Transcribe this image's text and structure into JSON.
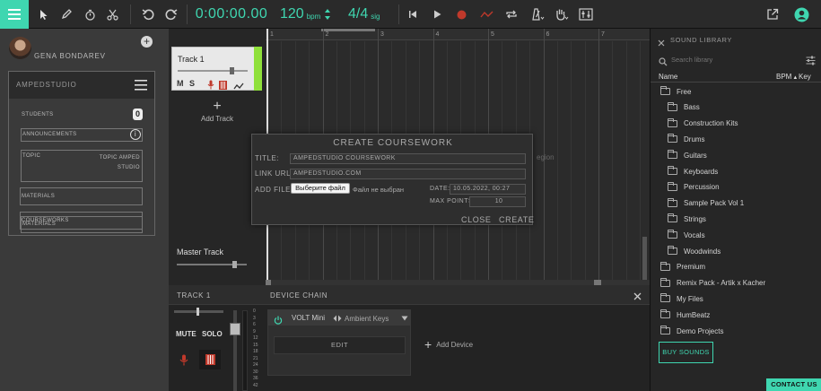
{
  "topbar": {
    "time": "0:00:00.00",
    "tempo": "120",
    "tempo_unit": "bpm",
    "signature": "4/4",
    "signature_unit": "sig"
  },
  "user": {
    "name": "GENA BONDAREV"
  },
  "lms": {
    "brand": "AMPEDSTUDIO",
    "students_label": "STUDENTS",
    "students_count": "0",
    "announcements_label": "ANNOUNCEMENTS",
    "topic_label": "TOPIC",
    "topic_value": "TOPIC AMPED STUDIO",
    "materials_label": "MATERIALS",
    "coursework_label": "COURSEWORKS"
  },
  "tracks": [
    {
      "name": "Track 1",
      "mute": "M",
      "solo": "S"
    }
  ],
  "add_track": "Add Track",
  "master_track": "Master Track",
  "ruler": [
    "1",
    "2",
    "3",
    "4",
    "5",
    "6",
    "7"
  ],
  "region_hint": "egion",
  "coursework": {
    "title": "CREATE COURSEWORK",
    "title_label": "TITLE:",
    "title_value": "AMPEDSTUDIO COURSEWORK",
    "link_label": "LINK URL:",
    "link_value": "AMPEDSTUDIO.COM",
    "file_label": "ADD FILE:",
    "file_button": "Выберите файл",
    "file_status": "Файл не выбран",
    "date_label": "DATE:",
    "date_value": "10.05.2022, 00:27",
    "max_label": "MAX POINTS:",
    "max_value": "10",
    "close": "CLOSE",
    "create": "CREATE"
  },
  "channel": {
    "name": "TRACK 1",
    "mute": "MUTE",
    "solo": "SOLO",
    "meter_ticks": [
      "0",
      "3",
      "6",
      "9",
      "12",
      "15",
      "18",
      "21",
      "24",
      "30",
      "36",
      "42"
    ]
  },
  "device_chain": {
    "title": "DEVICE CHAIN",
    "device": "VOLT Mini",
    "preset": "Ambient Keys",
    "edit": "EDIT",
    "add": "Add Device"
  },
  "library": {
    "title": "SOUND LIBRARY",
    "search_placeholder": "Search library",
    "col_name": "Name",
    "col_bpm": "BPM",
    "col_key": "Key",
    "items": [
      {
        "label": "Free",
        "indent": 0
      },
      {
        "label": "Bass",
        "indent": 1
      },
      {
        "label": "Construction Kits",
        "indent": 1
      },
      {
        "label": "Drums",
        "indent": 1
      },
      {
        "label": "Guitars",
        "indent": 1
      },
      {
        "label": "Keyboards",
        "indent": 1
      },
      {
        "label": "Percussion",
        "indent": 1
      },
      {
        "label": "Sample Pack Vol 1",
        "indent": 1
      },
      {
        "label": "Strings",
        "indent": 1
      },
      {
        "label": "Vocals",
        "indent": 1
      },
      {
        "label": "Woodwinds",
        "indent": 1
      },
      {
        "label": "Premium",
        "indent": 0
      },
      {
        "label": "Remix Pack - Artik x Kacher",
        "indent": 0
      },
      {
        "label": "My Files",
        "indent": 0
      },
      {
        "label": "HumBeatz",
        "indent": 0
      },
      {
        "label": "Demo Projects",
        "indent": 0
      }
    ],
    "buy": "BUY SOUNDS"
  },
  "contact": "CONTACT US",
  "colors": {
    "accent": "#3fd6b0",
    "track_green": "#8fe03a",
    "record": "#c0392b"
  }
}
